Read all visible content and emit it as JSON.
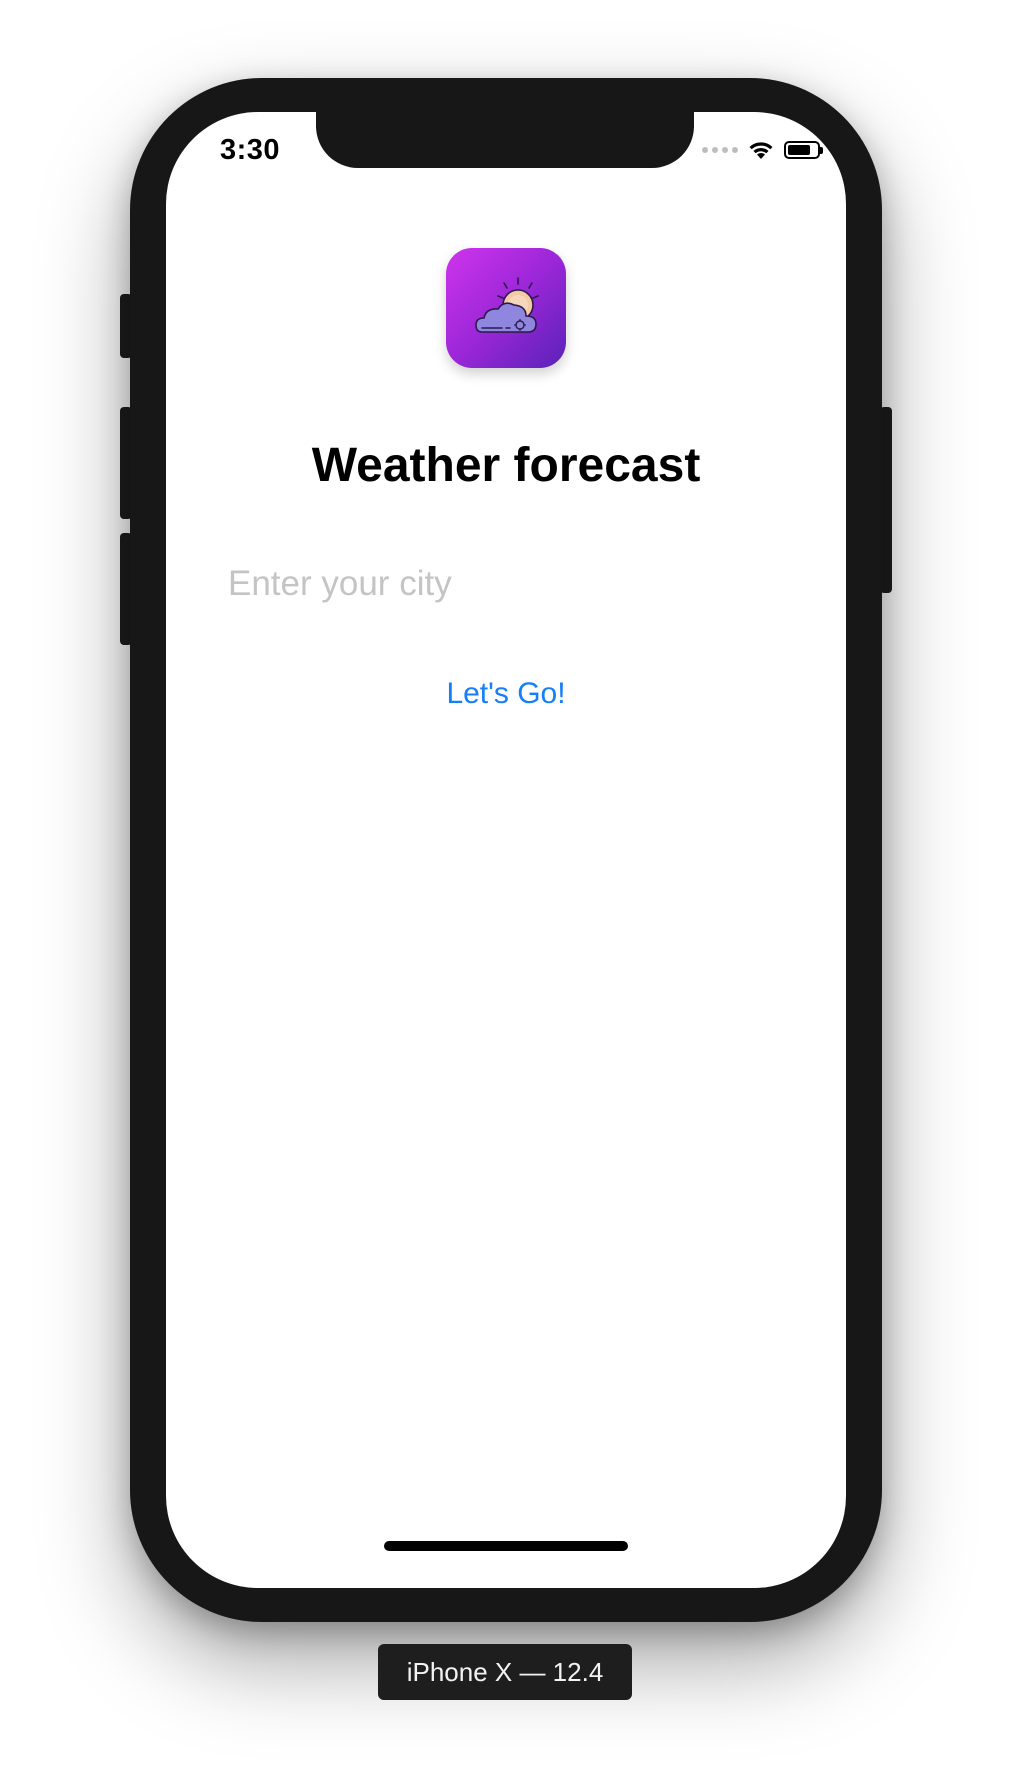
{
  "status_bar": {
    "time": "3:30",
    "icons": [
      "signal-dots-icon",
      "wifi-icon",
      "battery-icon"
    ],
    "battery_level": 0.8
  },
  "app": {
    "icon": "weather-cloud-sun-icon",
    "icon_gradient": [
      "#cf34ec",
      "#5a22b8"
    ],
    "title": "Weather forecast",
    "city_input": {
      "value": "",
      "placeholder": "Enter your city"
    },
    "go_button_label": "Let's Go!",
    "accent_color": "#147efb"
  },
  "simulator": {
    "device_label": "iPhone X — 12.4"
  }
}
